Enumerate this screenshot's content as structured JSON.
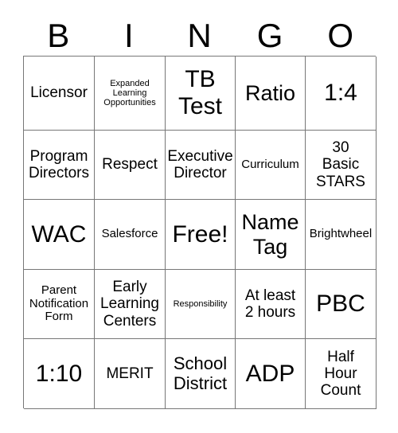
{
  "card": {
    "header_letters": [
      "B",
      "I",
      "N",
      "G",
      "O"
    ],
    "grid_size": "5x5",
    "colors": {
      "background": "#ffffff",
      "text": "#000000",
      "border": "#777777"
    },
    "rows": [
      [
        {
          "label": "Licensor",
          "size": "md"
        },
        {
          "label": "Expanded\nLearning\nOpportunities",
          "size": "xs"
        },
        {
          "label": "TB\nTest",
          "size": "xxl"
        },
        {
          "label": "Ratio",
          "size": "xl"
        },
        {
          "label": "1:4",
          "size": "xxl"
        }
      ],
      [
        {
          "label": "Program\nDirectors",
          "size": "md"
        },
        {
          "label": "Respect",
          "size": "md"
        },
        {
          "label": "Executive\nDirector",
          "size": "md"
        },
        {
          "label": "Curriculum",
          "size": "sm"
        },
        {
          "label": "30\nBasic\nSTARS",
          "size": "md"
        }
      ],
      [
        {
          "label": "WAC",
          "size": "xxl"
        },
        {
          "label": "Salesforce",
          "size": "sm"
        },
        {
          "label": "Free!",
          "size": "xxl"
        },
        {
          "label": "Name\nTag",
          "size": "xl"
        },
        {
          "label": "Brightwheel",
          "size": "sm"
        }
      ],
      [
        {
          "label": "Parent\nNotification\nForm",
          "size": "sm"
        },
        {
          "label": "Early\nLearning\nCenters",
          "size": "md"
        },
        {
          "label": "Responsibility",
          "size": "xs"
        },
        {
          "label": "At least\n2 hours",
          "size": "md"
        },
        {
          "label": "PBC",
          "size": "xxl"
        }
      ],
      [
        {
          "label": "1:10",
          "size": "xxl"
        },
        {
          "label": "MERIT",
          "size": "md"
        },
        {
          "label": "School\nDistrict",
          "size": "lg"
        },
        {
          "label": "ADP",
          "size": "xxl"
        },
        {
          "label": "Half\nHour\nCount",
          "size": "md"
        }
      ]
    ]
  }
}
